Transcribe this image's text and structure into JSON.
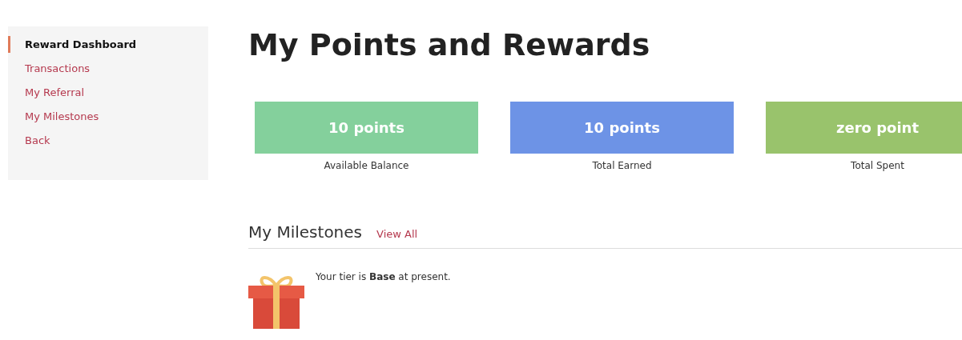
{
  "sidebar": {
    "items": [
      {
        "label": "Reward Dashboard",
        "selected": true
      },
      {
        "label": "Transactions",
        "selected": false
      },
      {
        "label": "My Referral",
        "selected": false
      },
      {
        "label": "My Milestones",
        "selected": false
      },
      {
        "label": "Back",
        "selected": false
      }
    ]
  },
  "title": "My Points and Rewards",
  "stats": [
    {
      "value": "10 points",
      "label": "Available Balance",
      "color": "#84d09c"
    },
    {
      "value": "10 points",
      "label": "Total Earned",
      "color": "#6d93e6"
    },
    {
      "value": "zero point",
      "label": "Total Spent",
      "color": "#99c36c"
    }
  ],
  "milestones": {
    "heading": "My Milestones",
    "link": "View All",
    "message": "Your tier is **Base** at present."
  }
}
